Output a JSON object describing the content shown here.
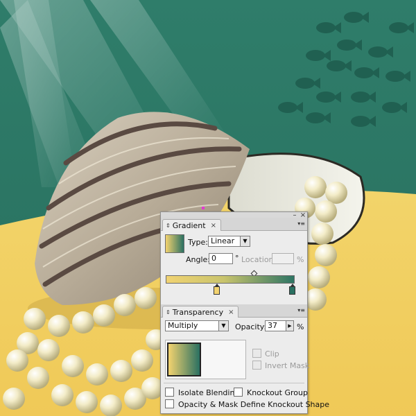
{
  "gradient_panel": {
    "tab_label": "Gradient",
    "type_label": "Type:",
    "type_value": "Linear",
    "angle_label": "Angle:",
    "angle_value": "0",
    "degree_symbol": "°",
    "location_label": "Location:",
    "location_value": "",
    "percent_symbol": "%",
    "colors": {
      "start": "#f3d36f",
      "end": "#2a7061"
    }
  },
  "transparency_panel": {
    "tab_label": "Transparency",
    "blend_mode": "Multiply",
    "opacity_label": "Opacity:",
    "opacity_value": "37",
    "percent_symbol": "%",
    "clip_label": "Clip",
    "invert_mask_label": "Invert Mask",
    "isolate_blending_label": "Isolate Blending",
    "knockout_group_label": "Knockout Group",
    "opacity_mask_label": "Opacity & Mask Define Knockout Shape"
  },
  "icons": {
    "close": "close-icon",
    "minimize": "minimize-icon",
    "tab_chevron": "chevron-updown-icon",
    "panel_menu": "panel-menu-icon",
    "dropdown": "chevron-down-icon"
  },
  "colors": {
    "sea": "#2b7563",
    "sand": "#f2d066",
    "panel_bg": "#ececec"
  }
}
